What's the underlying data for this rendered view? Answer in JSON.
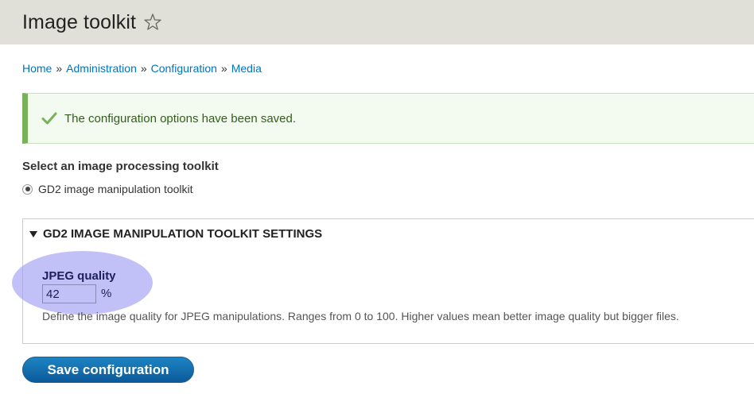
{
  "header": {
    "title": "Image toolkit",
    "shortcut_icon": "star-icon"
  },
  "breadcrumb": {
    "items": [
      "Home",
      "Administration",
      "Configuration",
      "Media"
    ],
    "separator": "»"
  },
  "status": {
    "icon": "check-icon",
    "message": "The configuration options have been saved.",
    "color": "#77b259"
  },
  "toolkit": {
    "label": "Select an image processing toolkit",
    "options": [
      {
        "label": "GD2 image manipulation toolkit",
        "selected": true
      }
    ]
  },
  "settings": {
    "summary": "GD2 image manipulation toolkit settings",
    "expanded": true,
    "jpeg_quality": {
      "label": "JPEG quality",
      "value": "42",
      "unit": "%",
      "description": "Define the image quality for JPEG manipulations. Ranges from 0 to 100. Higher values mean better image quality but bigger files."
    }
  },
  "actions": {
    "save_label": "Save configuration",
    "accent_color": "#0c67a8"
  }
}
